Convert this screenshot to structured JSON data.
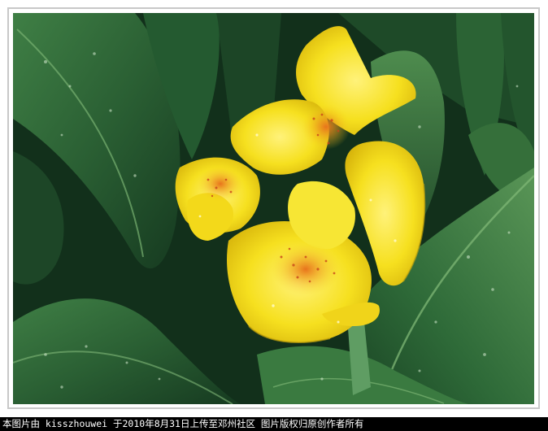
{
  "photo": {
    "subject": "yellow canna lily flower with wet green leaves",
    "colors": {
      "leaf_dark": "#0f2a17",
      "leaf_mid": "#2f6b3a",
      "leaf_light": "#5c9a5a",
      "petal": "#f5df1e",
      "petal_shadow": "#d9b710",
      "speckle": "#d0561a",
      "frame_border": "#c8c8c8"
    }
  },
  "caption": {
    "text": "本图片由 kisszhouwei 于2010年8月31日上传至邓州社区 图片版权归原创作者所有"
  }
}
